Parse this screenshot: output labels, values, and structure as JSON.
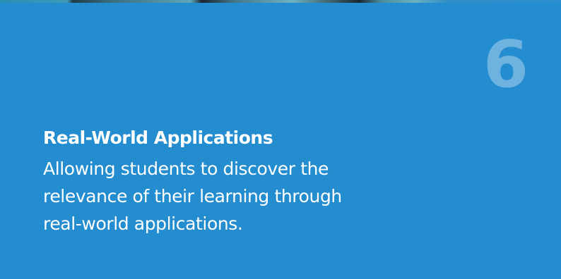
{
  "feature": {
    "number": "6",
    "title": "Real-World Applications",
    "description_lines": [
      "Allowing students to discover the",
      "relevance of their learning through",
      "real-world applications."
    ]
  },
  "colors": {
    "card_background": "#238dd0",
    "number": "#6eb2e0",
    "text": "#ffffff"
  }
}
